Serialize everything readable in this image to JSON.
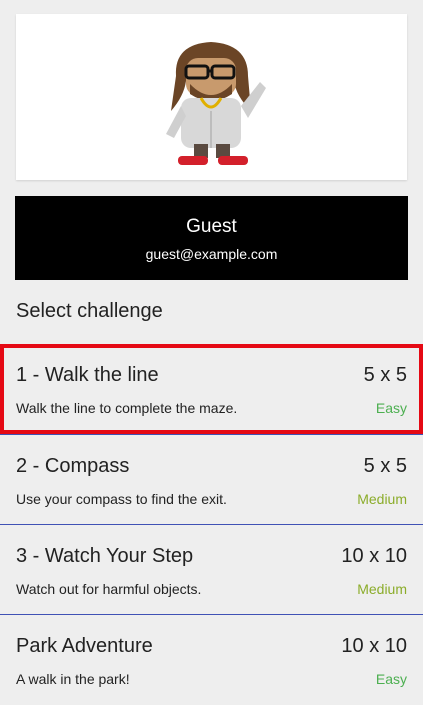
{
  "user": {
    "name": "Guest",
    "email": "guest@example.com"
  },
  "section_title": "Select challenge",
  "challenges": [
    {
      "title": "1 - Walk the line",
      "size": "5 x 5",
      "description": "Walk the line to complete the maze.",
      "difficulty": "Easy"
    },
    {
      "title": "2 - Compass",
      "size": "5 x 5",
      "description": "Use your compass to find the exit.",
      "difficulty": "Medium"
    },
    {
      "title": "3 - Watch Your Step",
      "size": "10 x 10",
      "description": "Watch out for harmful objects.",
      "difficulty": "Medium"
    },
    {
      "title": "Park Adventure",
      "size": "10 x 10",
      "description": "A walk in the park!",
      "difficulty": "Easy"
    }
  ],
  "colors": {
    "selected_outline": "#e50914",
    "easy": "#4caf50",
    "medium": "#8bac2a",
    "divider": "#3f51b5"
  },
  "icons": {
    "hero": "android-mascot-avatar-icon"
  }
}
